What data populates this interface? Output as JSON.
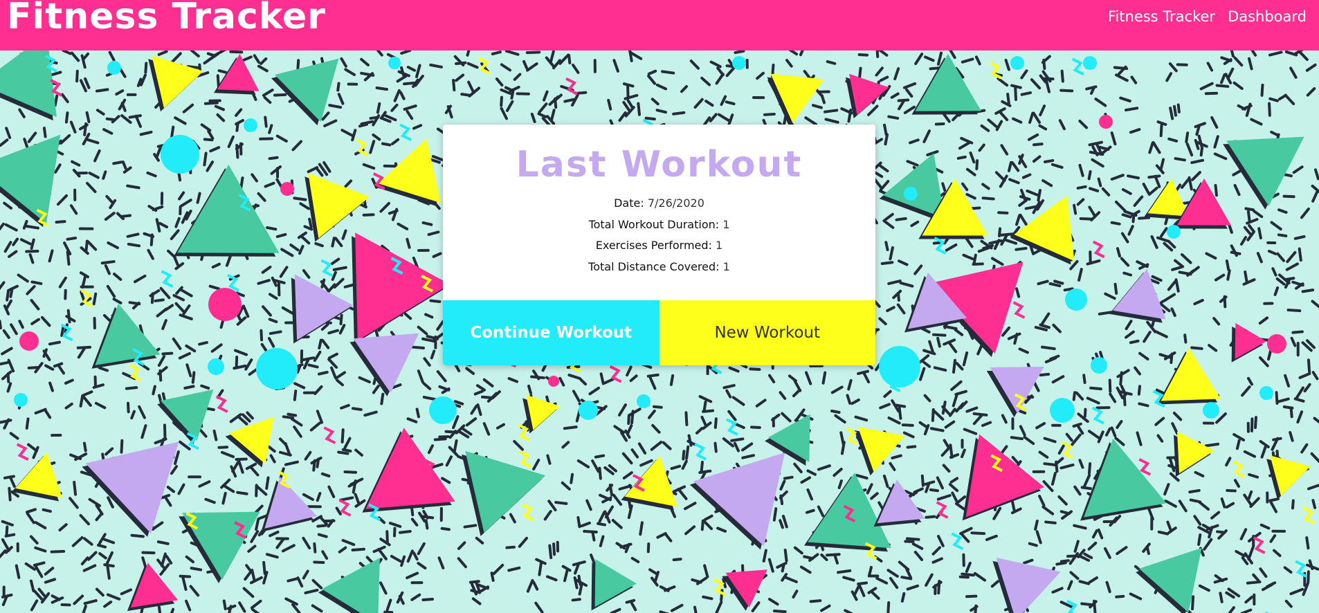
{
  "header": {
    "brand": "Fitness Tracker",
    "nav": [
      {
        "label": "Fitness Tracker"
      },
      {
        "label": "Dashboard"
      }
    ]
  },
  "card": {
    "title": "Last Workout",
    "stats": [
      {
        "label": "Date",
        "value": "7/26/2020"
      },
      {
        "label": "Total Workout Duration",
        "value": "1"
      },
      {
        "label": "Exercises Performed",
        "value": "1"
      },
      {
        "label": "Total Distance Covered",
        "value": "1"
      }
    ],
    "actions": {
      "continue_label": "Continue Workout",
      "new_label": "New Workout"
    }
  },
  "colors": {
    "header": "#ff2f92",
    "title": "#c5a9f0",
    "continue_button": "#22ecfa",
    "new_button": "#ffff1c",
    "background": "#c6f2ea"
  }
}
